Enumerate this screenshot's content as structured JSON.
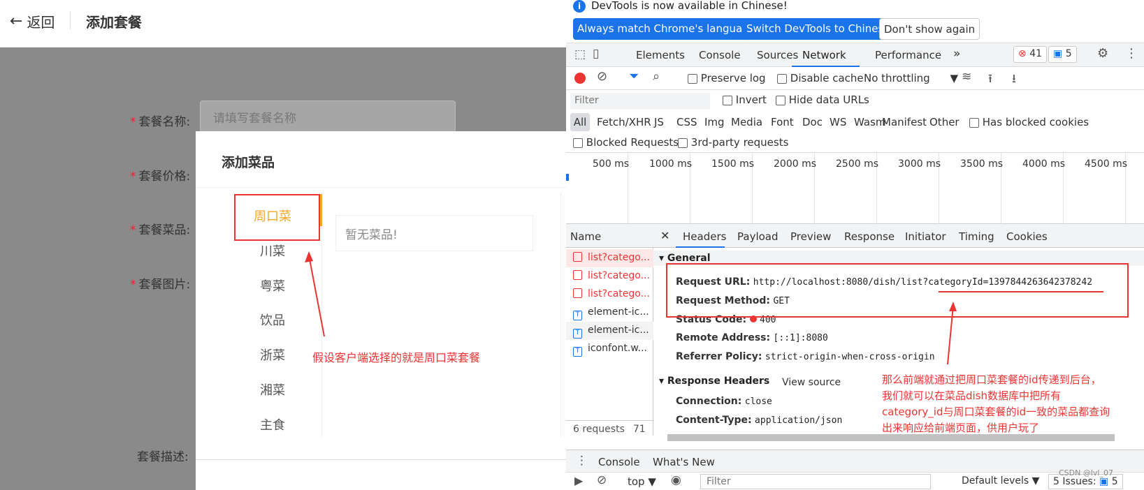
{
  "left": {
    "back_label": "返回",
    "page_title": "添加套餐",
    "form": {
      "name_label": "套餐名称:",
      "name_placeholder": "请填写套餐名称",
      "price_label": "套餐价格:",
      "dishes_label": "套餐菜品:",
      "image_label": "套餐图片:",
      "desc_label": "套餐描述:",
      "star": "*"
    },
    "dialog": {
      "title": "添加菜品",
      "categories": [
        "周口菜",
        "川菜",
        "粤菜",
        "饮品",
        "浙菜",
        "湘菜",
        "主食"
      ],
      "active_category": "周口菜",
      "empty_text": "暂无菜品!"
    },
    "annotation": "假设客户端选择的就是周口菜套餐"
  },
  "devtools": {
    "info_text": "DevTools is now available in Chinese!",
    "btn_match": "Always match Chrome's language",
    "btn_switch": "Switch DevTools to Chinese",
    "btn_dont": "Don't show again",
    "tabs": [
      "Elements",
      "Console",
      "Sources",
      "Network",
      "Performance"
    ],
    "active_tab": "Network",
    "more_tabs": "»",
    "error_count": "41",
    "message_count": "5",
    "toolbar": {
      "preserve_log": "Preserve log",
      "disable_cache": "Disable cache",
      "throttling": "No throttling"
    },
    "filter_placeholder": "Filter",
    "invert": "Invert",
    "hide_data_urls": "Hide data URLs",
    "types": [
      "All",
      "Fetch/XHR",
      "JS",
      "CSS",
      "Img",
      "Media",
      "Font",
      "Doc",
      "WS",
      "Wasm",
      "Manifest",
      "Other"
    ],
    "has_blocked_cookies": "Has blocked cookies",
    "blocked_requests": "Blocked Requests",
    "third_party": "3rd-party requests",
    "timeline_ticks": [
      "500 ms",
      "1000 ms",
      "1500 ms",
      "2000 ms",
      "2500 ms",
      "3000 ms",
      "3500 ms",
      "4000 ms",
      "4500 ms"
    ],
    "name_header": "Name",
    "requests": [
      {
        "name": "list?catego...",
        "error": true
      },
      {
        "name": "list?catego...",
        "error": true
      },
      {
        "name": "list?catego...",
        "error": true
      },
      {
        "name": "element-ic...",
        "error": false
      },
      {
        "name": "element-ic...",
        "error": false
      },
      {
        "name": "iconfont.w...",
        "error": false
      }
    ],
    "request_count": "6 requests",
    "request_size": "71",
    "header_tabs": [
      "Headers",
      "Payload",
      "Preview",
      "Response",
      "Initiator",
      "Timing",
      "Cookies"
    ],
    "general_title": "General",
    "general": {
      "request_url_key": "Request URL:",
      "request_url": "http://localhost:8080/dish/list?categoryId=1397844263642378242",
      "method_key": "Request Method:",
      "method": "GET",
      "status_key": "Status Code:",
      "status": "400",
      "remote_key": "Remote Address:",
      "remote": "[::1]:8080",
      "referrer_key": "Referrer Policy:",
      "referrer": "strict-origin-when-cross-origin"
    },
    "response_headers_title": "Response Headers",
    "view_source": "View source",
    "response_headers": {
      "connection_key": "Connection:",
      "connection": "close",
      "content_type_key": "Content-Type:",
      "content_type": "application/json"
    },
    "drawer_tabs": [
      "Console",
      "What's New"
    ],
    "console_bar": {
      "context": "top",
      "filter": "Filter",
      "levels": "Default levels",
      "issues": "5 Issues:",
      "issues_count": "5"
    },
    "annotation": [
      "那么前端就通过把周口菜套餐的id传递到后台，",
      "我们就可以在菜品dish数据库中把所有",
      "category_id与周口菜套餐的id一致的菜品都查询",
      "出来响应给前端页面，供用户玩了"
    ],
    "watermark": "CSDN @lvl_07"
  },
  "colors": {
    "accent": "#1a73e8",
    "active_category": "#f5a623",
    "error": "#e33"
  }
}
